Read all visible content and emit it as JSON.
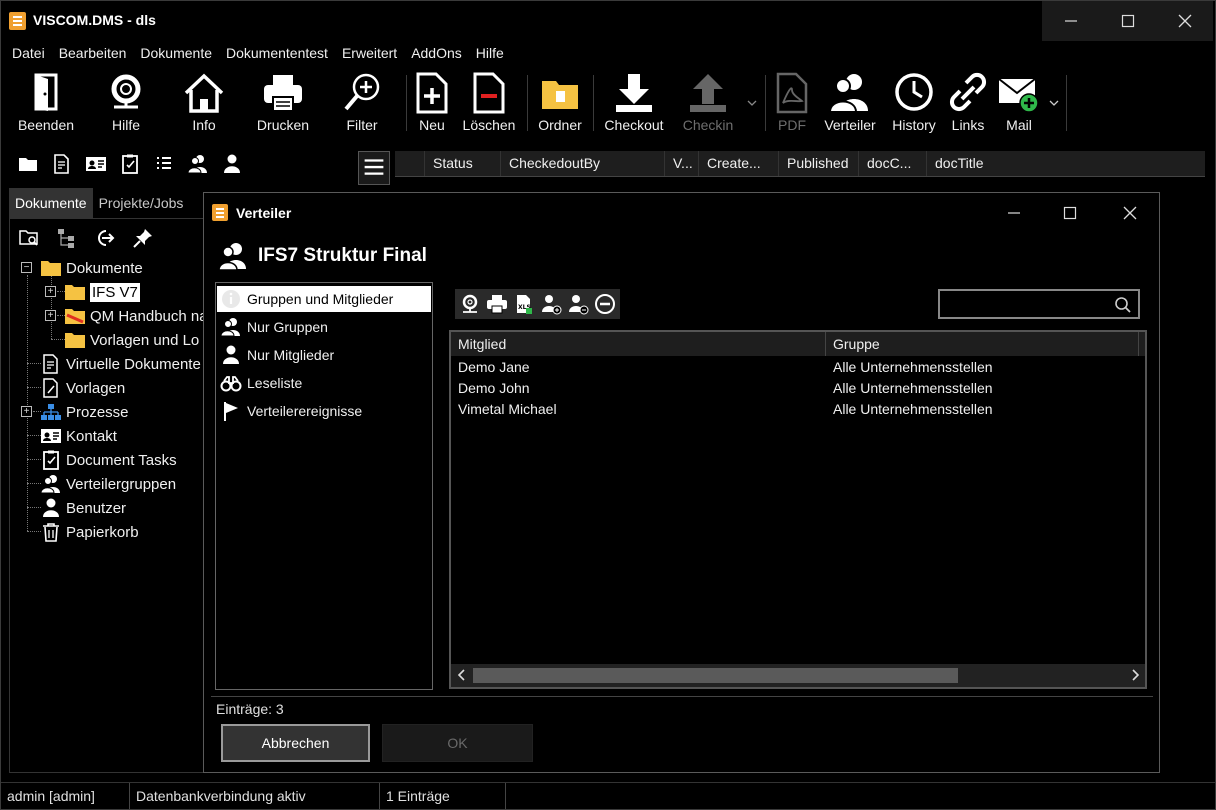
{
  "window": {
    "title": "VISCOM.DMS - dls"
  },
  "menu": [
    "Datei",
    "Bearbeiten",
    "Dokumente",
    "Dokumententest",
    "Erweitert",
    "AddOns",
    "Hilfe"
  ],
  "toolbar": {
    "beenden": "Beenden",
    "hilfe": "Hilfe",
    "info": "Info",
    "drucken": "Drucken",
    "filter": "Filter",
    "neu": "Neu",
    "loeschen": "Löschen",
    "ordner": "Ordner",
    "checkout": "Checkout",
    "checkin": "Checkin",
    "pdf": "PDF",
    "verteiler": "Verteiler",
    "history": "History",
    "links": "Links",
    "mail": "Mail"
  },
  "left_tabs": {
    "dokumente": "Dokumente",
    "projekte": "Projekte/Jobs"
  },
  "tree": {
    "root": "Dokumente",
    "ifs": "IFS V7",
    "qm": "QM Handbuch na",
    "vorlagen_lo": "Vorlagen und Lo",
    "virtuelle": "Virtuelle Dokumente",
    "vorlagen": "Vorlagen",
    "prozesse": "Prozesse",
    "kontakt": "Kontakt",
    "tasks": "Document Tasks",
    "verteilergruppen": "Verteilergruppen",
    "benutzer": "Benutzer",
    "papierkorb": "Papierkorb"
  },
  "grid": {
    "columns": [
      "Status",
      "CheckedoutBy",
      "V...",
      "Create...",
      "Published",
      "docC...",
      "docTitle"
    ]
  },
  "dialog": {
    "title": "Verteiler",
    "heading": "IFS7 Struktur Final",
    "nav": {
      "gruppen_mitglieder": "Gruppen und Mitglieder",
      "nur_gruppen": "Nur Gruppen",
      "nur_mitglieder": "Nur Mitglieder",
      "leseliste": "Leseliste",
      "ereignisse": "Verteilerereignisse"
    },
    "search_placeholder": "",
    "columns": {
      "mitglied": "Mitglied",
      "gruppe": "Gruppe"
    },
    "rows": [
      {
        "mitglied": "Demo Jane",
        "gruppe": "Alle Unternehmensstellen"
      },
      {
        "mitglied": "Demo John",
        "gruppe": "Alle Unternehmensstellen"
      },
      {
        "mitglied": "Vimetal Michael",
        "gruppe": "Alle Unternehmensstellen"
      }
    ],
    "count": "Einträge: 3",
    "cancel": "Abbrechen",
    "ok": "OK"
  },
  "status": {
    "user": "admin [admin]",
    "db": "Datenbankverbindung aktiv",
    "entries": "1 Einträge"
  },
  "colors": {
    "accent": "#f0a030",
    "background": "#000000",
    "selection": "#ffffff"
  }
}
